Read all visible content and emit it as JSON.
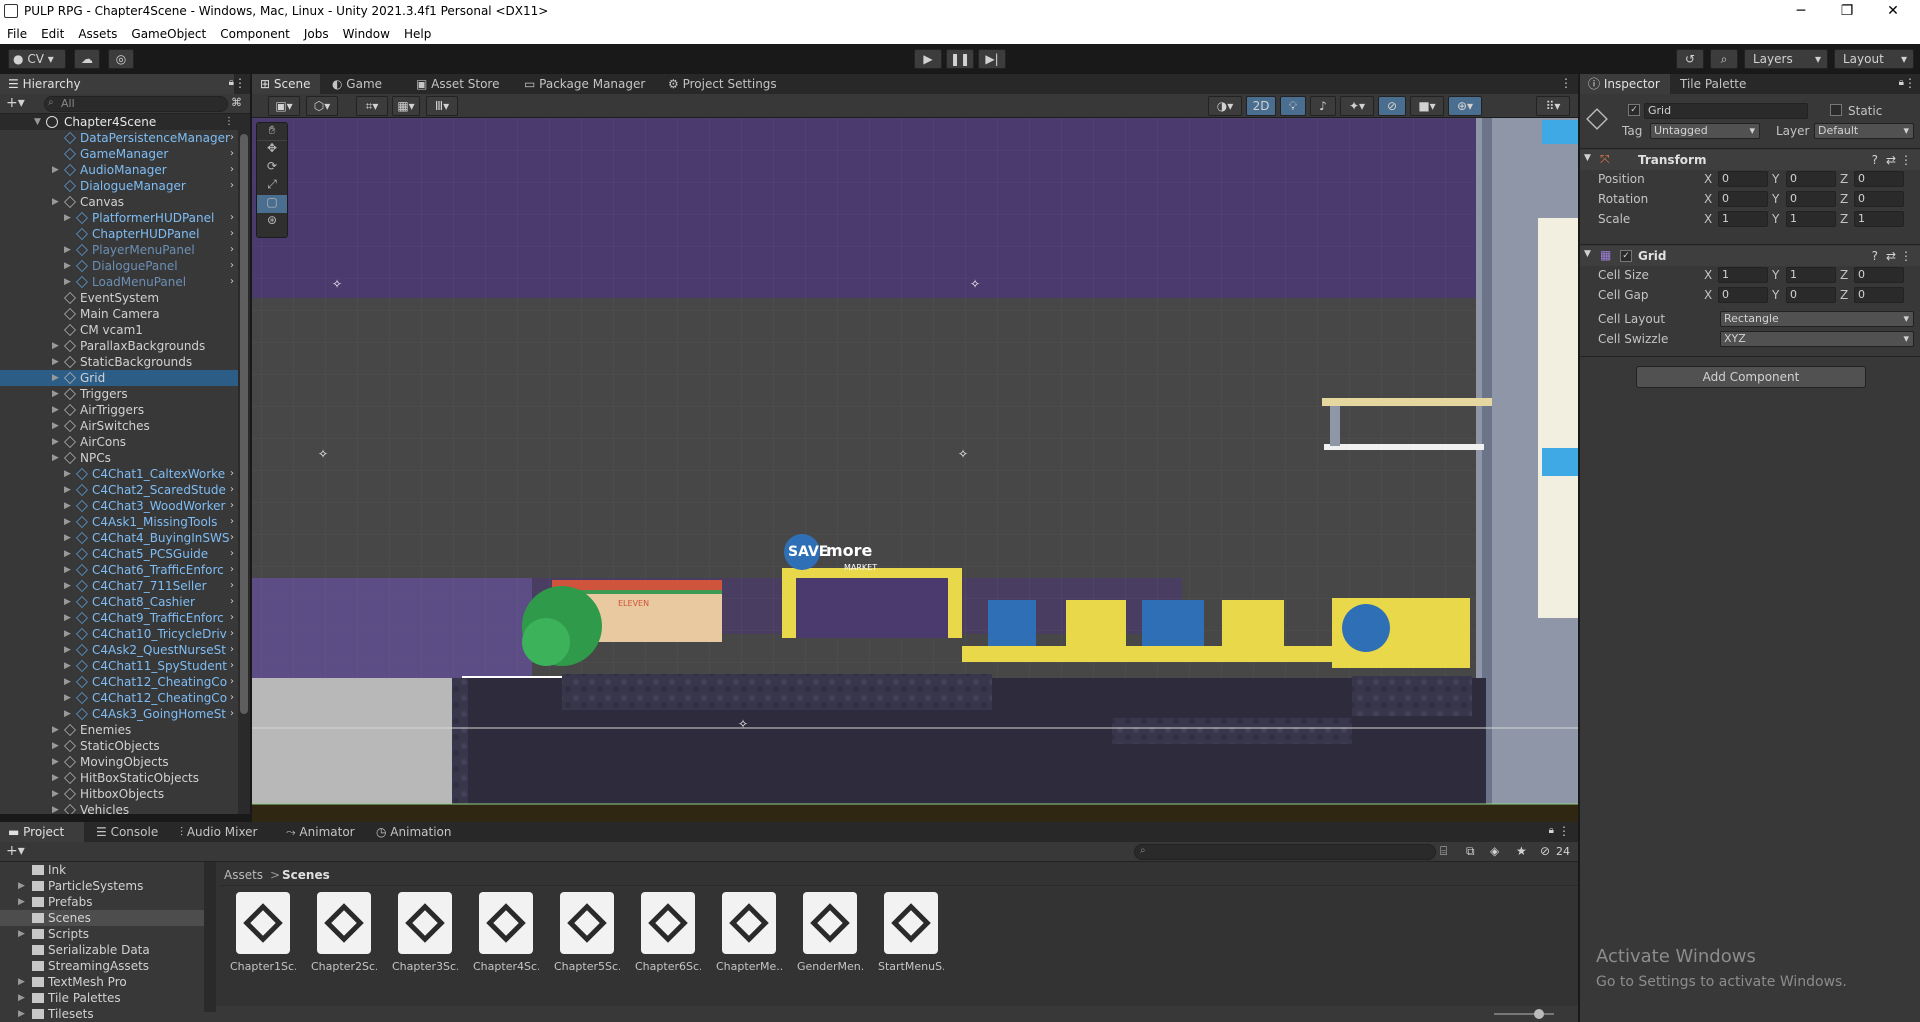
{
  "window": {
    "title": "PULP RPG - Chapter4Scene - Windows, Mac, Linux - Unity 2021.3.4f1 Personal <DX11>",
    "minimize": "─",
    "maximize": "❐",
    "close": "✕"
  },
  "menu": [
    "File",
    "Edit",
    "Assets",
    "GameObject",
    "Component",
    "Jobs",
    "Window",
    "Help"
  ],
  "toolbar": {
    "account": "CV",
    "layers_label": "Layers",
    "layout_label": "Layout"
  },
  "hierarchy": {
    "tab": "Hierarchy",
    "search_placeholder": "All",
    "root": "Chapter4Scene",
    "items": [
      {
        "label": "DataPersistenceManager",
        "indent": 2,
        "prefab": true,
        "arrow": false
      },
      {
        "label": "GameManager",
        "indent": 2,
        "prefab": true,
        "arrow": false
      },
      {
        "label": "AudioManager",
        "indent": 2,
        "prefab": true,
        "arrow": true
      },
      {
        "label": "DialogueManager",
        "indent": 2,
        "prefab": true,
        "arrow": false
      },
      {
        "label": "Canvas",
        "indent": 2,
        "prefab": false,
        "arrow": true
      },
      {
        "label": "PlatformerHUDPanel",
        "indent": 3,
        "prefab": true,
        "arrow": true
      },
      {
        "label": "ChapterHUDPanel",
        "indent": 3,
        "prefab": true,
        "arrow": false
      },
      {
        "label": "PlayerMenuPanel",
        "indent": 3,
        "prefab": true,
        "arrow": true,
        "dim": true
      },
      {
        "label": "DialoguePanel",
        "indent": 3,
        "prefab": true,
        "arrow": true,
        "dim": true
      },
      {
        "label": "LoadMenuPanel",
        "indent": 3,
        "prefab": true,
        "arrow": true,
        "dim": true
      },
      {
        "label": "EventSystem",
        "indent": 2,
        "prefab": false,
        "arrow": false
      },
      {
        "label": "Main Camera",
        "indent": 2,
        "prefab": false,
        "arrow": false
      },
      {
        "label": "CM vcam1",
        "indent": 2,
        "prefab": false,
        "arrow": false
      },
      {
        "label": "ParallaxBackgrounds",
        "indent": 2,
        "prefab": false,
        "arrow": true
      },
      {
        "label": "StaticBackgrounds",
        "indent": 2,
        "prefab": false,
        "arrow": true
      },
      {
        "label": "Grid",
        "indent": 2,
        "prefab": false,
        "arrow": true,
        "selected": true
      },
      {
        "label": "Triggers",
        "indent": 2,
        "prefab": false,
        "arrow": true
      },
      {
        "label": "AirTriggers",
        "indent": 2,
        "prefab": false,
        "arrow": true
      },
      {
        "label": "AirSwitches",
        "indent": 2,
        "prefab": false,
        "arrow": true
      },
      {
        "label": "AirCons",
        "indent": 2,
        "prefab": false,
        "arrow": true
      },
      {
        "label": "NPCs",
        "indent": 2,
        "prefab": false,
        "arrow": true
      },
      {
        "label": "C4Chat1_CaltexWorke",
        "indent": 3,
        "prefab": true,
        "arrow": true
      },
      {
        "label": "C4Chat2_ScaredStude",
        "indent": 3,
        "prefab": true,
        "arrow": true
      },
      {
        "label": "C4Chat3_WoodWorker",
        "indent": 3,
        "prefab": true,
        "arrow": true
      },
      {
        "label": "C4Ask1_MissingTools",
        "indent": 3,
        "prefab": true,
        "arrow": true
      },
      {
        "label": "C4Chat4_BuyingInSWS",
        "indent": 3,
        "prefab": true,
        "arrow": true
      },
      {
        "label": "C4Chat5_PCSGuide",
        "indent": 3,
        "prefab": true,
        "arrow": true
      },
      {
        "label": "C4Chat6_TrafficEnforc",
        "indent": 3,
        "prefab": true,
        "arrow": true
      },
      {
        "label": "C4Chat7_711Seller",
        "indent": 3,
        "prefab": true,
        "arrow": true
      },
      {
        "label": "C4Chat8_Cashier",
        "indent": 3,
        "prefab": true,
        "arrow": true
      },
      {
        "label": "C4Chat9_TrafficEnforc",
        "indent": 3,
        "prefab": true,
        "arrow": true
      },
      {
        "label": "C4Chat10_TricycleDriv",
        "indent": 3,
        "prefab": true,
        "arrow": true
      },
      {
        "label": "C4Ask2_QuestNurseSt",
        "indent": 3,
        "prefab": true,
        "arrow": true
      },
      {
        "label": "C4Chat11_SpyStudent",
        "indent": 3,
        "prefab": true,
        "arrow": true
      },
      {
        "label": "C4Chat12_CheatingCo",
        "indent": 3,
        "prefab": true,
        "arrow": true
      },
      {
        "label": "C4Chat12_CheatingCo",
        "indent": 3,
        "prefab": true,
        "arrow": true
      },
      {
        "label": "C4Ask3_GoingHomeSt",
        "indent": 3,
        "prefab": true,
        "arrow": true
      },
      {
        "label": "Enemies",
        "indent": 2,
        "prefab": false,
        "arrow": true
      },
      {
        "label": "StaticObjects",
        "indent": 2,
        "prefab": false,
        "arrow": true
      },
      {
        "label": "MovingObjects",
        "indent": 2,
        "prefab": false,
        "arrow": true
      },
      {
        "label": "HitBoxStaticObjects",
        "indent": 2,
        "prefab": false,
        "arrow": true
      },
      {
        "label": "HitboxObjects",
        "indent": 2,
        "prefab": false,
        "arrow": true
      },
      {
        "label": "Vehicles",
        "indent": 2,
        "prefab": false,
        "arrow": true
      }
    ]
  },
  "scene_tabs": [
    "Scene",
    "Game",
    "Asset Store",
    "Package Manager",
    "Project Settings"
  ],
  "scene": {
    "mode_2d": "2D",
    "sign_save": "SAVE",
    "sign_more": "more",
    "sign_market": "MARKET",
    "store_label": "ELEVEN"
  },
  "inspector": {
    "tabs": [
      "Inspector",
      "Tile Palette"
    ],
    "object_name": "Grid",
    "static_label": "Static",
    "tag_label": "Tag",
    "tag_value": "Untagged",
    "layer_label": "Layer",
    "layer_value": "Default",
    "transform": {
      "title": "Transform",
      "rows": [
        {
          "label": "Position",
          "x": "0",
          "y": "0",
          "z": "0"
        },
        {
          "label": "Rotation",
          "x": "0",
          "y": "0",
          "z": "0"
        },
        {
          "label": "Scale",
          "x": "1",
          "y": "1",
          "z": "1"
        }
      ]
    },
    "grid": {
      "title": "Grid",
      "rows": [
        {
          "label": "Cell Size",
          "x": "1",
          "y": "1",
          "z": "0"
        },
        {
          "label": "Cell Gap",
          "x": "0",
          "y": "0",
          "z": "0"
        }
      ],
      "layout_label": "Cell Layout",
      "layout_value": "Rectangle",
      "swizzle_label": "Cell Swizzle",
      "swizzle_value": "XYZ"
    },
    "add_component": "Add Component",
    "watermark_title": "Activate Windows",
    "watermark_sub": "Go to Settings to activate Windows."
  },
  "bottom_tabs": [
    "Project",
    "Console",
    "Audio Mixer",
    "Animator",
    "Animation"
  ],
  "project": {
    "breadcrumb_root": "Assets",
    "breadcrumb_sep": ">",
    "breadcrumb_current": "Scenes",
    "hidden_count": "24",
    "folders": [
      {
        "label": "Ink",
        "arrow": false
      },
      {
        "label": "ParticleSystems",
        "arrow": true
      },
      {
        "label": "Prefabs",
        "arrow": true
      },
      {
        "label": "Scenes",
        "arrow": false,
        "selected": true
      },
      {
        "label": "Scripts",
        "arrow": true
      },
      {
        "label": "Serializable Data",
        "arrow": false
      },
      {
        "label": "StreamingAssets",
        "arrow": false
      },
      {
        "label": "TextMesh Pro",
        "arrow": true
      },
      {
        "label": "Tile Palettes",
        "arrow": true
      },
      {
        "label": "Tilesets",
        "arrow": true
      }
    ],
    "assets": [
      "Chapter1Sc...",
      "Chapter2Sc...",
      "Chapter3Sc...",
      "Chapter4Sc...",
      "Chapter5Sc...",
      "Chapter6Sc...",
      "ChapterMe...",
      "GenderMen...",
      "StartMenuS..."
    ]
  },
  "colors": {
    "selection": "#2c5d87",
    "prefab_text": "#7ebdf5",
    "scene_purple": "#4a3a6e",
    "scene_gray": "#474747",
    "ground": "#2d2b3c",
    "yellow": "#e8d84a",
    "blue": "#2f6fb5"
  }
}
